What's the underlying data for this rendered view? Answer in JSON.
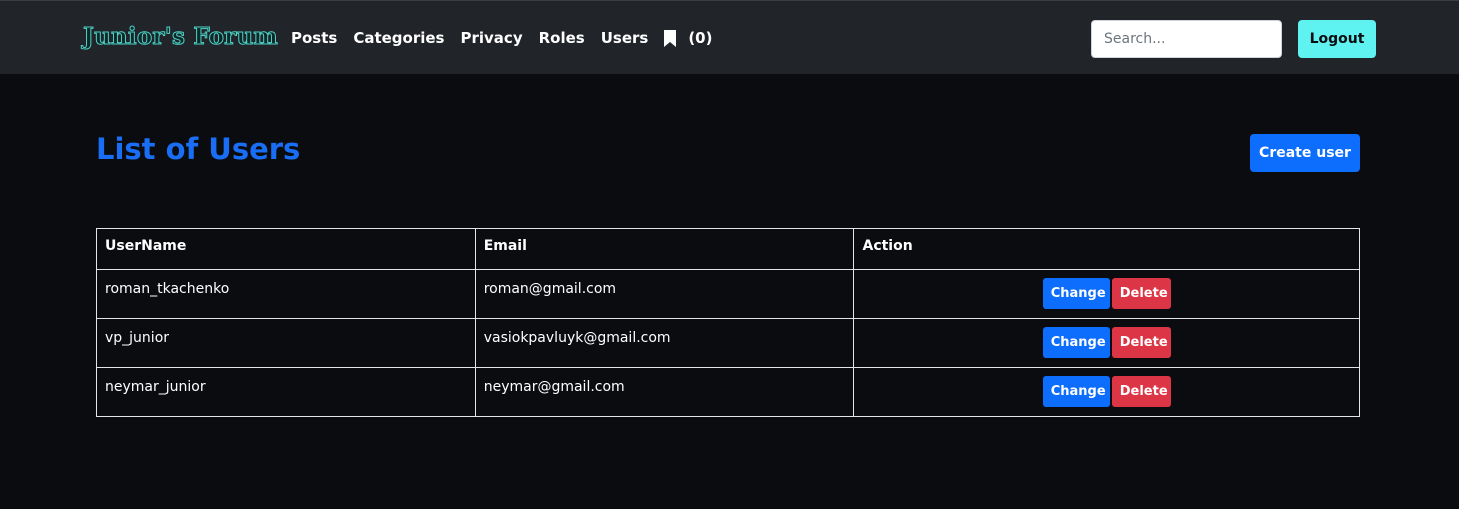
{
  "navbar": {
    "brand": "Junior's Forum",
    "links": [
      {
        "label": "Posts"
      },
      {
        "label": "Categories"
      },
      {
        "label": "Privacy"
      },
      {
        "label": "Roles"
      },
      {
        "label": "Users"
      }
    ],
    "bookmark_icon": "bookmark-icon",
    "bookmark_count": "(0)",
    "search_placeholder": "Search...",
    "logout_label": "Logout"
  },
  "main": {
    "title": "List of Users",
    "create_label": "Create user",
    "table": {
      "headers": [
        "UserName",
        "Email",
        "Action"
      ],
      "rows": [
        {
          "username": "roman_tkachenko",
          "email": "roman@gmail.com",
          "change": "Change",
          "delete": "Delete"
        },
        {
          "username": "vp_junior",
          "email": "vasiokpavluyk@gmail.com",
          "change": "Change",
          "delete": "Delete"
        },
        {
          "username": "neymar_junior",
          "email": "neymar@gmail.com",
          "change": "Change",
          "delete": "Delete"
        }
      ]
    }
  },
  "colors": {
    "navbar_bg": "#212429",
    "page_bg": "#0a0c10",
    "title": "#1a6ef5",
    "primary": "#0d6efd",
    "danger": "#dc3545",
    "logout": "#5ef3f0",
    "brand_outline": "#4fd1c5"
  }
}
